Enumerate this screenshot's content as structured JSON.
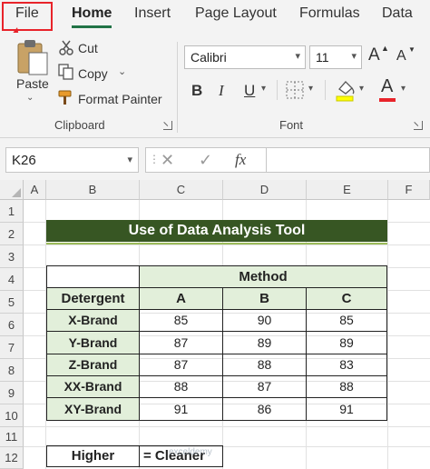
{
  "ribbon_tabs": {
    "file": "File",
    "home": "Home",
    "insert": "Insert",
    "page_layout": "Page Layout",
    "formulas": "Formulas",
    "data": "Data"
  },
  "clipboard": {
    "paste": "Paste",
    "cut": "Cut",
    "copy": "Copy",
    "format_painter": "Format Painter",
    "group_label": "Clipboard"
  },
  "font": {
    "family": "Calibri",
    "size": "11",
    "grow_label": "A",
    "shrink_label": "A",
    "bold": "B",
    "italic": "I",
    "underline": "U",
    "font_color_label": "A",
    "group_label": "Font",
    "font_color": "#e8232a",
    "fill_color": "#ffff00"
  },
  "formula_bar": {
    "name_box": "K26",
    "fx_label": "fx",
    "formula": ""
  },
  "sheet": {
    "columns": [
      "A",
      "B",
      "C",
      "D",
      "E",
      "F"
    ],
    "rows": [
      "1",
      "2",
      "3",
      "4",
      "5",
      "6",
      "7",
      "8",
      "9",
      "10",
      "11",
      "12"
    ],
    "title": "Use of Data Analysis Tool",
    "header_method": "Method",
    "header_detergent": "Detergent",
    "method_cols": [
      "A",
      "B",
      "C"
    ],
    "brands": [
      {
        "name": "X-Brand",
        "a": "85",
        "b": "90",
        "c": "85"
      },
      {
        "name": "Y-Brand",
        "a": "87",
        "b": "89",
        "c": "89"
      },
      {
        "name": "Z-Brand",
        "a": "87",
        "b": "88",
        "c": "83"
      },
      {
        "name": "XX-Brand",
        "a": "88",
        "b": "87",
        "c": "88"
      },
      {
        "name": "XY-Brand",
        "a": "91",
        "b": "86",
        "c": "91"
      }
    ],
    "higher_label": "Higher",
    "higher_value": "= Cleaner",
    "accent_color": "#375623",
    "table_fill": "#e2efda"
  },
  "watermark": "exceldemy"
}
